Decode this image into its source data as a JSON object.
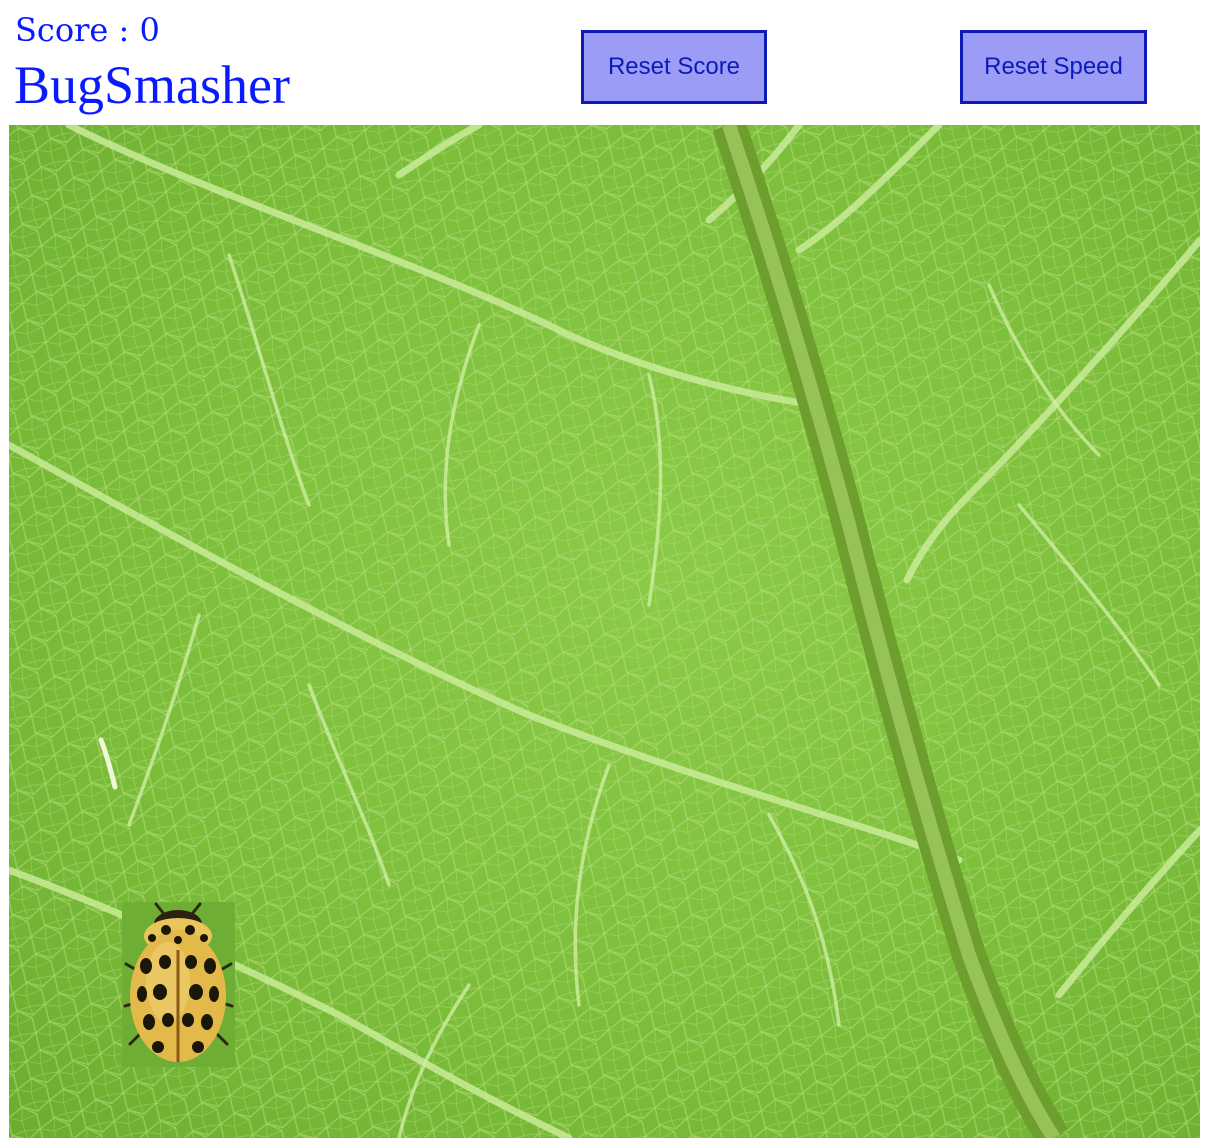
{
  "header": {
    "score_label": "Score : 0",
    "title": "BugSmasher"
  },
  "buttons": {
    "reset_score_label": "Reset Score",
    "reset_speed_label": "Reset Speed"
  },
  "game": {
    "background": "leaf",
    "sprite": "ladybug-icon"
  },
  "colors": {
    "text_blue": "#0a1aff",
    "button_fill": "#9a9cf5",
    "button_border": "#0d1ab8",
    "leaf_green": "#7fbf3f"
  }
}
